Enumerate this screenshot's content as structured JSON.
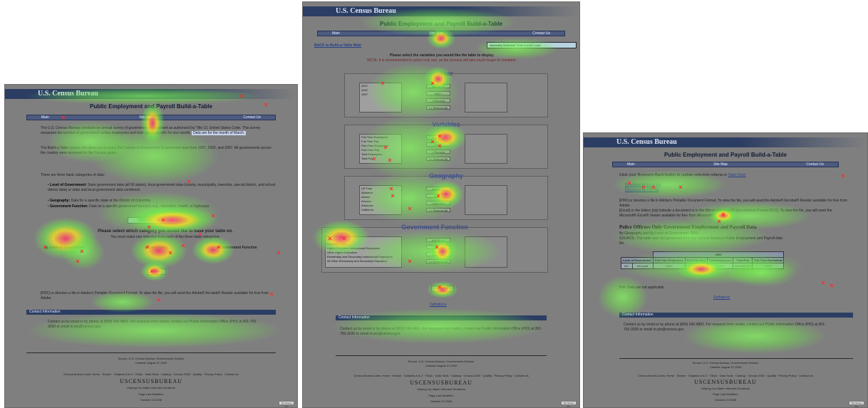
{
  "agency": "U.S. Census Bureau",
  "page_title": "Public Employment and Payroll Build-a-Table",
  "nav": {
    "main": "Main",
    "site_map": "Site Map",
    "contact": "Contact Us"
  },
  "screen1": {
    "intro1": "The U.S. Census Bureau conducts an annual survey of government employment as authorized by Title 13, United States Code. This survey measures the number of government civilian employees and their gross payrolls for one month.",
    "intro1_highlight": "Data are for the month of March.",
    "intro2": "The Build-a-Table system will allow you to query the Census of Government Employment data from 1997, 2002, and 2007. All governments across the country were surveyed for the Census years.",
    "categories_intro": "There are three basic categories of data:",
    "bullets": [
      {
        "term": "Level of Government:",
        "text": "State government data (all 50 states), local government data (county, municipality, township, special district, and school district data) or state and local government data combined."
      },
      {
        "term": "Geography:",
        "text": "Data for a specific state or the District of Columbia."
      },
      {
        "term": "Government Function:",
        "text": "Data on a specific government function, e.g., education, health, or highways."
      }
    ],
    "continue_button": "Continue Reading",
    "prompt": "Please select which category you would like to base your table on.",
    "prompt_sub": "You must make one selection from each of the three table categories.",
    "radio_level": "Level of Government",
    "radio_geo": "Geography",
    "radio_function": "Government Function",
    "next_button": "Next",
    "pdf_note": "[PDF] or denotes a file in Adobe's Portable Document Format. To view the file, you will need the Adobe® Acrobat® Reader available for free from Adobe.",
    "contact_header": "Contact Information",
    "contact_text": "Contact us by email or by phone at (800) 242-4901. For requests from media, contact our Public Information Office (PIO) at 301-763-3030 or email to pio@census.gov.",
    "source": "Source: U.S. Census Bureau, Governments Division",
    "created": "Created: August 21 2009",
    "links": "Census Bureau Links: Home · Search · Subjects A to Z · FAQs · Data Tools · Catalog · Census 2000 · Quality · Privacy Policy · Contact Us",
    "logo": "USCENSUSBUREAU",
    "tagline": "Helping You Make Informed Decisions",
    "last_modified": "Page Last Modified:",
    "modified_date": "October 23 2008",
    "corner_badge": "Top Screen Pro"
  },
  "screen2": {
    "back_link": "BACK to Build-a-Table Main",
    "currently_selected_label": "Currently Selected:",
    "currently_selected_value": "State and All Local",
    "instruction": "Please select the variables you would like the table to display",
    "note": "NOTE: It is recommended to select only one, as the process will take much longer to complete.",
    "sections": [
      {
        "title": "Year",
        "items": [
          "2007",
          "2002",
          "1997"
        ]
      },
      {
        "title": "Variables",
        "items": [
          "Full-Time Employees",
          "Full-Time Pay",
          "Part-Time Employees",
          "Part-Time Pay",
          "Total Employees",
          "Total Pay"
        ]
      },
      {
        "title": "Geography",
        "items": [
          "US Total",
          "Alabama",
          "Alaska",
          "Arizona",
          "Arkansas",
          "California"
        ]
      },
      {
        "title": "Government Function",
        "items": [
          "Total",
          "Education Total",
          "Higher Education Instructional Employees",
          "Other Higher Education",
          "Elementary and Secondary Instructional Employees",
          "All Other Elementary and Secondary Education"
        ]
      }
    ],
    "buttons": [
      "Add All >>",
      "Add >",
      "< Remove",
      "<< Remove All"
    ],
    "submit": "Submit",
    "definitions": "Definitions",
    "contact_header": "Contact Information",
    "contact_text": "Contact us by email or by phone at (800) 242-4901. For requests from media, contact our Public Information Office (PIO) at 301-763-3030 or email to pio@census.gov.",
    "source": "Source: U.S. Census Bureau, Governments Division",
    "created": "Created: August 21 2009",
    "links": "Census Bureau Links: Home · Search · Subjects A to Z · FAQs · Data Tools · Catalog · Census 2000 · Quality · Privacy Policy · Contact Us",
    "logo": "USCENSUSBUREAU",
    "tagline": "Helping You Make Informed Decisions",
    "last_modified": "Page Last Modified:",
    "modified_date": "October 23 2008",
    "corner_badge": "Top Screen Pro"
  },
  "screen3": {
    "instruction": "Click your Browsers Back button to update selection criteria or",
    "start_over": "Start Over",
    "downloads": [
      "Download as Excel file",
      "Download as PDF file"
    ],
    "pdf_note": "[PDF] or denotes a file in Adobe's Portable Document Format. To view the file, you will need the Adobe® Acrobat® Reader available for free from Adobe.",
    "excel_note": "[Excel] or the letters [xls] indicate a document is in the Microsoft® Excel® Spreadsheet Format (XLS). To view the file, you will need the Microsoft® Excel® Viewer available for free from Microsoft®.",
    "result_title": "Police Officers Only Government Employment and Payroll Data",
    "result_sub": "By Geography and By Level of Government: 2002",
    "source_note": "SOURCE: The table was last generated from the Census Bureau's Public Employment and Payroll data file.",
    "table_year": "2002",
    "headers": [
      "Level of Government",
      "Full-Time Employees",
      "Full-Time Pay",
      "Total Employees",
      "Total Pay",
      "Full-Time Equivalent"
    ],
    "row": [
      "DC",
      "All Local",
      "3,997",
      "$16,388,176",
      "3,997",
      "$16,388,387",
      "3,997"
    ],
    "na_note": "N/A: Data are not applicable.",
    "definitions": "Definitions",
    "contact_header": "Contact Information",
    "contact_text": "Contact us by email or by phone at (800) 242-4901. For requests from media, contact our Public Information Office (PIO) at 301-763-3030 or email to pio@census.gov.",
    "source": "Source: U.S. Census Bureau, Governments Division",
    "created": "Created: August 21 2009",
    "links": "Census Bureau Links: Home · Search · Subjects A to Z · FAQs · Data Tools · Catalog · Census 2000 · Quality · Privacy Policy · Contact Us",
    "logo": "USCENSUSBUREAU",
    "tagline": "Helping You Make Informed Decisions",
    "last_modified": "Page Last Modified:",
    "modified_date": "October 23 2008",
    "corner_badge": "Top Screen Pro"
  }
}
